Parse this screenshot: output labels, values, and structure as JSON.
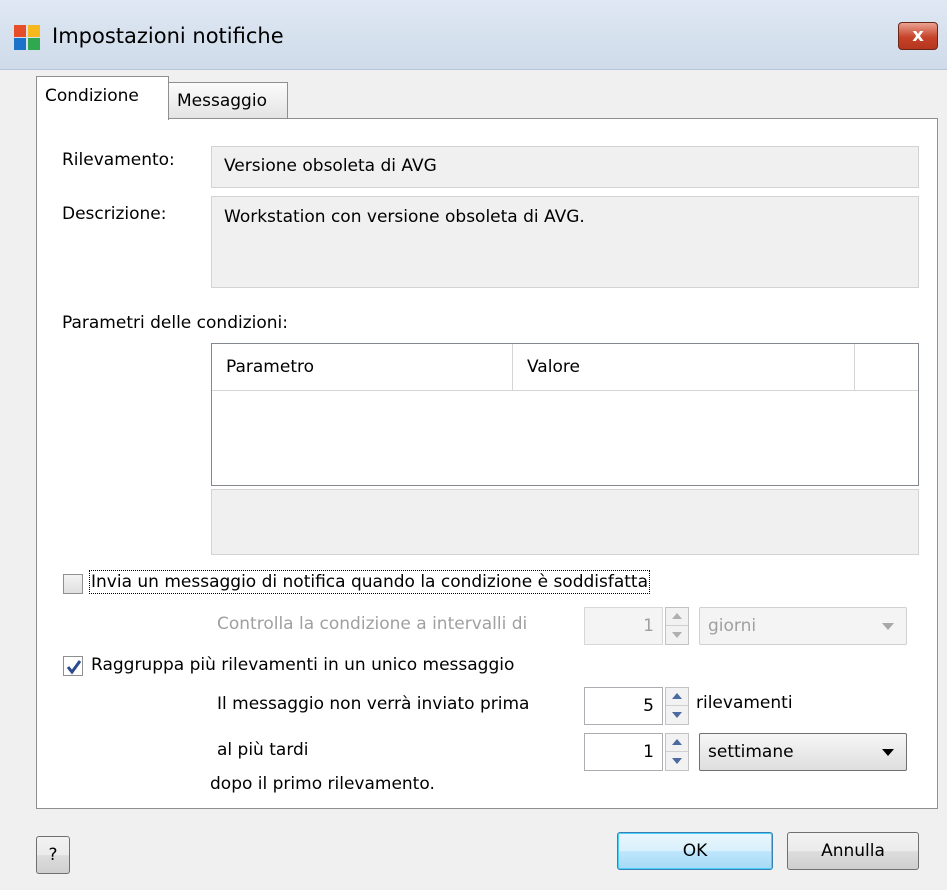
{
  "window": {
    "title": "Impostazioni notifiche",
    "close_label": "x"
  },
  "tabs": [
    {
      "label": "Condizione",
      "active": true
    },
    {
      "label": "Messaggio",
      "active": false
    }
  ],
  "fields": {
    "rilevamento_label": "Rilevamento:",
    "rilevamento_value": "Versione obsoleta di AVG",
    "descrizione_label": "Descrizione:",
    "descrizione_value": "Workstation con versione obsoleta di AVG."
  },
  "params": {
    "section_label": "Parametri delle condizioni:",
    "columns": [
      "Parametro",
      "Valore"
    ]
  },
  "notify": {
    "checkbox_label": "Invia un messaggio di notifica quando la condizione è soddisfatta",
    "checked": false,
    "interval_label": "Controlla la condizione a intervalli di",
    "interval_value": "1",
    "interval_unit": "giorni"
  },
  "group": {
    "checkbox_label": "Raggruppa più rilevamenti in un unico messaggio",
    "checked": true,
    "min_label": "Il messaggio non verrà inviato prima",
    "min_value": "5",
    "min_unit": "rilevamenti",
    "max_label": "al più tardi",
    "max_value": "1",
    "max_unit": "settimane",
    "after_label": "dopo il primo rilevamento."
  },
  "buttons": {
    "help": "?",
    "ok": "OK",
    "cancel": "Annulla"
  },
  "colors": {
    "close_red": "#c7432a",
    "check_blue": "#2a4b8d",
    "ok_blue": "#3c7fb1"
  }
}
